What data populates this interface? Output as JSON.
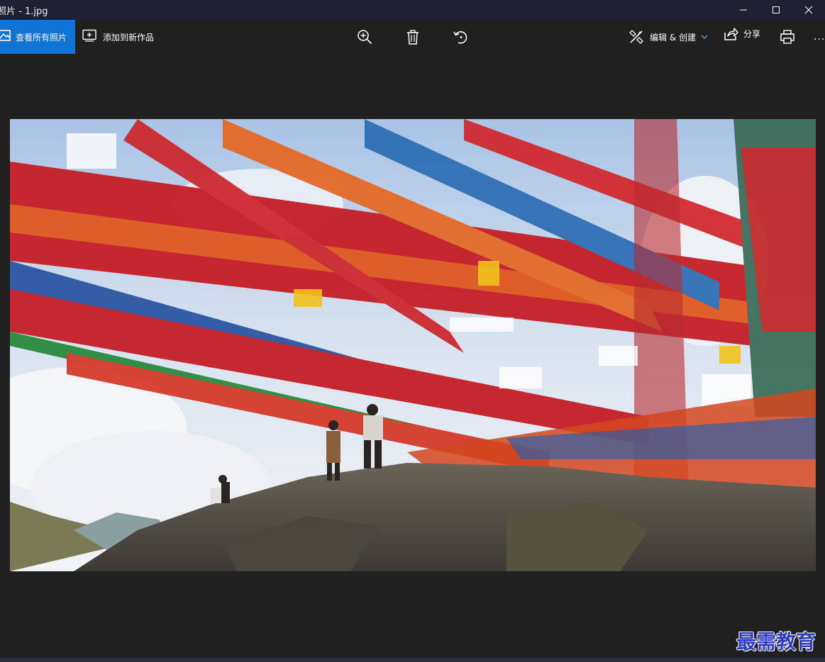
{
  "window": {
    "title": "照片 - 1.jpg",
    "controls": [
      "minimize-icon",
      "maximize-icon",
      "close-icon"
    ]
  },
  "toolbar": {
    "view_all_label": "查看所有照片",
    "add_to_creation_label": "添加到新作品",
    "zoom_icon": "zoom-in-icon",
    "delete_icon": "trash-icon",
    "rotate_icon": "rotate-icon",
    "edit_create_label": "编辑 & 创建",
    "share_label": "分享",
    "print_icon": "printer-icon",
    "more_label": "..."
  },
  "photo": {
    "subject": "prayer-flags-on-hillside",
    "alt": "1.jpg"
  },
  "colors": {
    "accent": "#0f74d6",
    "titlebar": "#1f2132",
    "background": "#202020",
    "watermark": "#2f3dbe"
  },
  "watermark": {
    "text": "最需教育"
  }
}
